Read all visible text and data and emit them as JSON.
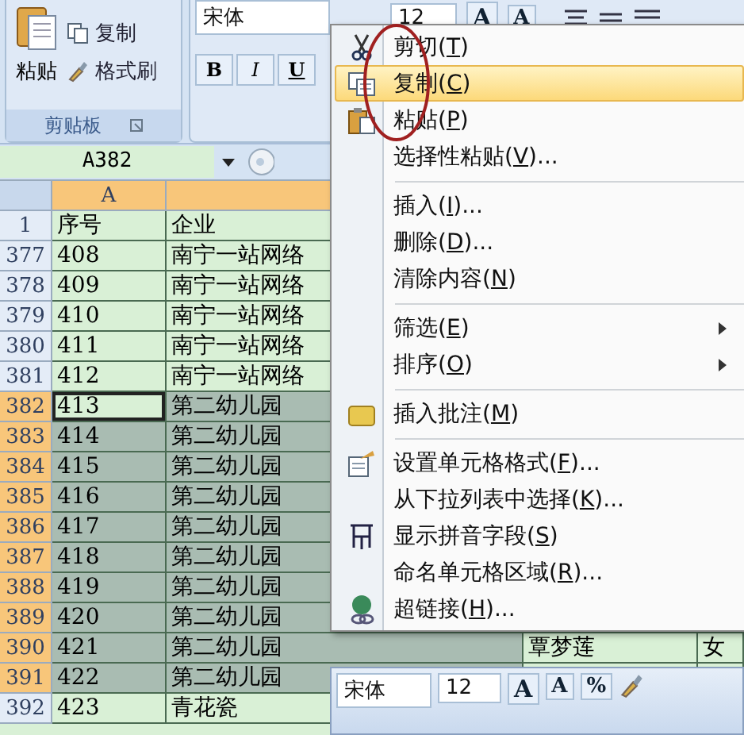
{
  "ribbon": {
    "clipboard": {
      "paste": "粘贴",
      "copy": "复制",
      "format_painter": "格式刷",
      "label": "剪贴板"
    },
    "font": {
      "font_name": "宋体",
      "size": "12",
      "style_buttons": [
        "B",
        "I",
        "U"
      ],
      "size_buttons": [
        "A",
        "A"
      ]
    }
  },
  "name_box": "A382",
  "columns": [
    {
      "label": "A",
      "selected": true
    },
    {
      "selected": true
    }
  ],
  "rows": [
    {
      "num": "1",
      "a": "序号",
      "b": "企业",
      "selected": false,
      "active": false
    },
    {
      "num": "377",
      "a": "408",
      "b": "南宁一站网络",
      "selected": false,
      "active": false
    },
    {
      "num": "378",
      "a": "409",
      "b": "南宁一站网络",
      "selected": false,
      "active": false
    },
    {
      "num": "379",
      "a": "410",
      "b": "南宁一站网络",
      "selected": false,
      "active": false
    },
    {
      "num": "380",
      "a": "411",
      "b": "南宁一站网络",
      "selected": false,
      "active": false
    },
    {
      "num": "381",
      "a": "412",
      "b": "南宁一站网络",
      "selected": false,
      "active": false
    },
    {
      "num": "382",
      "a": "413",
      "b": "第二幼儿园",
      "selected": true,
      "active": true
    },
    {
      "num": "383",
      "a": "414",
      "b": "第二幼儿园",
      "selected": true,
      "active": false
    },
    {
      "num": "384",
      "a": "415",
      "b": "第二幼儿园",
      "selected": true,
      "active": false
    },
    {
      "num": "385",
      "a": "416",
      "b": "第二幼儿园",
      "selected": true,
      "active": false
    },
    {
      "num": "386",
      "a": "417",
      "b": "第二幼儿园",
      "selected": true,
      "active": false
    },
    {
      "num": "387",
      "a": "418",
      "b": "第二幼儿园",
      "selected": true,
      "active": false
    },
    {
      "num": "388",
      "a": "419",
      "b": "第二幼儿园",
      "selected": true,
      "active": false
    },
    {
      "num": "389",
      "a": "420",
      "b": "第二幼儿园",
      "selected": true,
      "active": false
    },
    {
      "num": "390",
      "a": "421",
      "b": "第二幼儿园",
      "c": "覃梦莲",
      "d": "女",
      "selected": true,
      "active": false
    },
    {
      "num": "391",
      "a": "422",
      "b": "第二幼儿园",
      "selected": true,
      "active": false
    },
    {
      "num": "392",
      "a": "423",
      "b": "青花瓷",
      "selected": false,
      "active": false
    }
  ],
  "context_menu": {
    "items": [
      {
        "kind": "item",
        "before": "剪切(",
        "key": "T",
        "after": ")",
        "submenu": false,
        "selected": false,
        "circled": false
      },
      {
        "kind": "item",
        "before": "复制(",
        "key": "C",
        "after": ")",
        "submenu": false,
        "selected": true,
        "circled": true
      },
      {
        "kind": "item",
        "before": "粘贴(",
        "key": "P",
        "after": ")",
        "submenu": false,
        "selected": false,
        "circled": false
      },
      {
        "kind": "item",
        "before": "选择性粘贴(",
        "key": "V",
        "after": ")...",
        "submenu": false,
        "selected": false,
        "circled": false
      },
      {
        "kind": "separator"
      },
      {
        "kind": "item",
        "before": "插入(",
        "key": "I",
        "after": ")...",
        "submenu": false,
        "selected": false,
        "circled": false
      },
      {
        "kind": "item",
        "before": "删除(",
        "key": "D",
        "after": ")...",
        "submenu": false,
        "selected": false,
        "circled": false
      },
      {
        "kind": "item",
        "before": "清除内容(",
        "key": "N",
        "after": ")",
        "submenu": false,
        "selected": false,
        "circled": false
      },
      {
        "kind": "separator"
      },
      {
        "kind": "item",
        "before": "筛选(",
        "key": "E",
        "after": ")",
        "submenu": true,
        "selected": false,
        "circled": false
      },
      {
        "kind": "item",
        "before": "排序(",
        "key": "O",
        "after": ")",
        "submenu": true,
        "selected": false,
        "circled": false
      },
      {
        "kind": "separator"
      },
      {
        "kind": "item",
        "before": "插入批注(",
        "key": "M",
        "after": ")",
        "submenu": false,
        "selected": false,
        "circled": false
      },
      {
        "kind": "separator"
      },
      {
        "kind": "item",
        "before": "设置单元格格式(",
        "key": "F",
        "after": ")...",
        "submenu": false,
        "selected": false,
        "circled": false
      },
      {
        "kind": "item",
        "before": "从下拉列表中选择(",
        "key": "K",
        "after": ")...",
        "submenu": false,
        "selected": false,
        "circled": false
      },
      {
        "kind": "item",
        "before": "显示拼音字段(",
        "key": "S",
        "after": ")",
        "submenu": false,
        "selected": false,
        "circled": false
      },
      {
        "kind": "item",
        "before": "命名单元格区域(",
        "key": "R",
        "after": ")...",
        "submenu": false,
        "selected": false,
        "circled": false
      },
      {
        "kind": "item",
        "before": "超链接(",
        "key": "H",
        "after": ")...",
        "submenu": false,
        "selected": false,
        "circled": false
      }
    ]
  },
  "mini_toolbar": {
    "font_name": "宋体",
    "size": "12",
    "size_buttons": [
      "A",
      "A"
    ],
    "percent": "%"
  }
}
